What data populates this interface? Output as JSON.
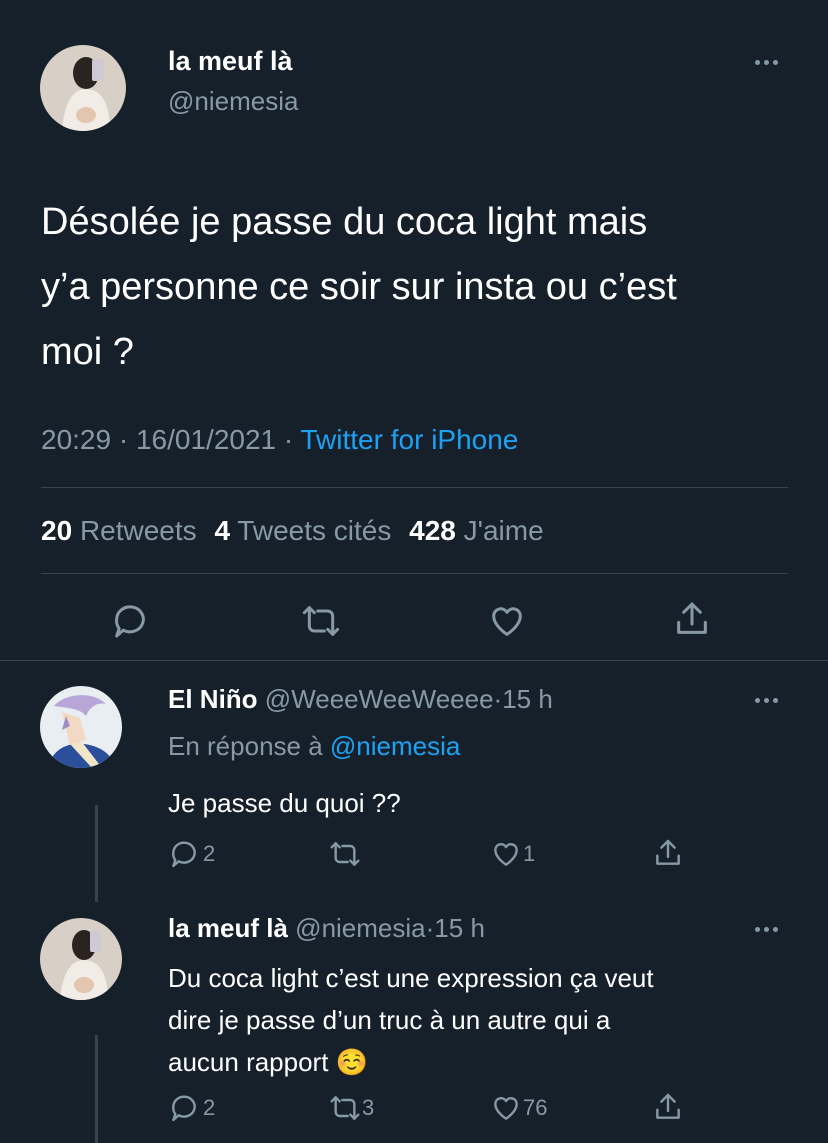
{
  "main_tweet": {
    "display_name": "la meuf là",
    "handle": "@niemesia",
    "text_line1": "Désolée je passe du coca light mais",
    "text_line2": "y’a personne ce soir sur insta ou c’est",
    "text_line3": "moi ?",
    "time": "20:29",
    "date": "16/01/2021",
    "separator": "·",
    "source": "Twitter for iPhone",
    "retweets_count": "20",
    "retweets_label": "Retweets",
    "quotes_count": "4",
    "quotes_label": "Tweets cités",
    "likes_count": "428",
    "likes_label": "J'aime"
  },
  "replies": [
    {
      "display_name": "El Niño",
      "handle": "@WeeeWeeWeeee",
      "time_ago": "15 h",
      "reply_prefix": "En réponse à",
      "reply_to": "@niemesia",
      "text": "Je passe du quoi ??",
      "reply_count": "2",
      "retweet_count": "",
      "like_count": "1"
    },
    {
      "display_name": "la meuf là",
      "handle": "@niemesia",
      "time_ago": "15 h",
      "text_line1": "Du coca light c’est une expression ça veut",
      "text_line2": "dire je passe d’un truc à un autre qui a",
      "text_line3": "aucun rapport",
      "emoji": "☺️",
      "reply_count": "2",
      "retweet_count": "3",
      "like_count": "76"
    }
  ],
  "colors": {
    "background": "#15202b",
    "text": "#ffffff",
    "secondary": "#8899a6",
    "link": "#1da1f2",
    "divider": "#38444d"
  },
  "icons": [
    "reply-icon",
    "retweet-icon",
    "like-icon",
    "share-icon",
    "more-icon"
  ]
}
